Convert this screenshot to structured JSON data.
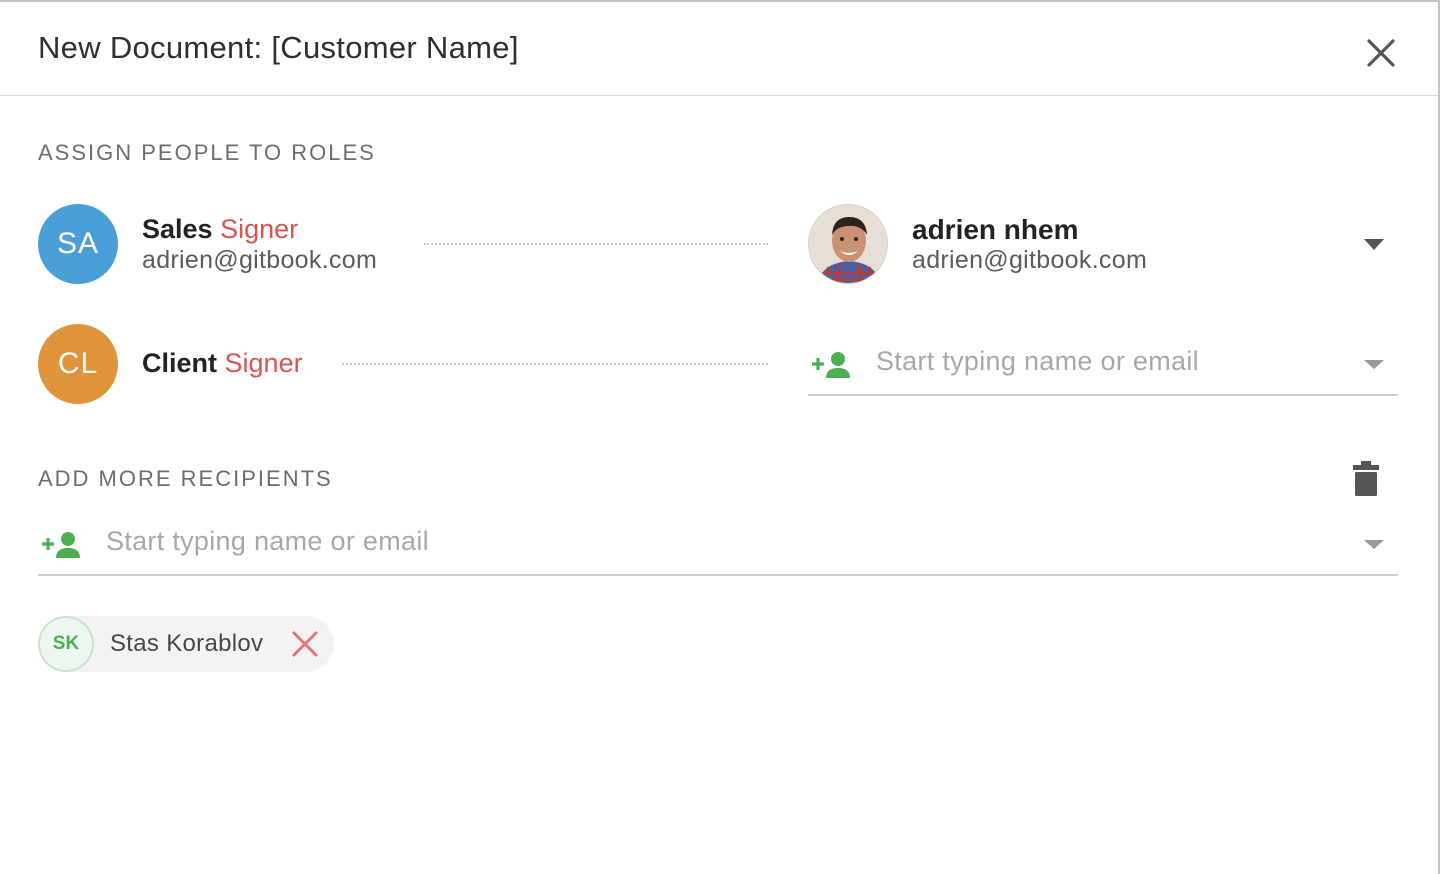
{
  "dialog": {
    "title": "New Document: [Customer Name]",
    "close_icon": "close-icon"
  },
  "roles_section": {
    "label": "ASSIGN PEOPLE TO ROLES",
    "roles": [
      {
        "initials": "SA",
        "avatar_color": "#4a9fd8",
        "name": "Sales",
        "role": "Signer",
        "email": "adrien@gitbook.com",
        "assignee": {
          "name": "adrien nhem",
          "email": "adrien@gitbook.com",
          "avatar_icon": "user-photo"
        }
      },
      {
        "initials": "CL",
        "avatar_color": "#e0943a",
        "name": "Client",
        "role": "Signer",
        "assignee_placeholder": "Start typing name or email"
      }
    ]
  },
  "recipients_section": {
    "label": "ADD MORE RECIPIENTS",
    "input_placeholder": "Start typing name or email",
    "chips": [
      {
        "initials": "SK",
        "name": "Stas Korablov"
      }
    ]
  },
  "colors": {
    "signer_accent": "#d9534f",
    "add_person_green": "#4caf50",
    "remove_red": "#e57373"
  }
}
